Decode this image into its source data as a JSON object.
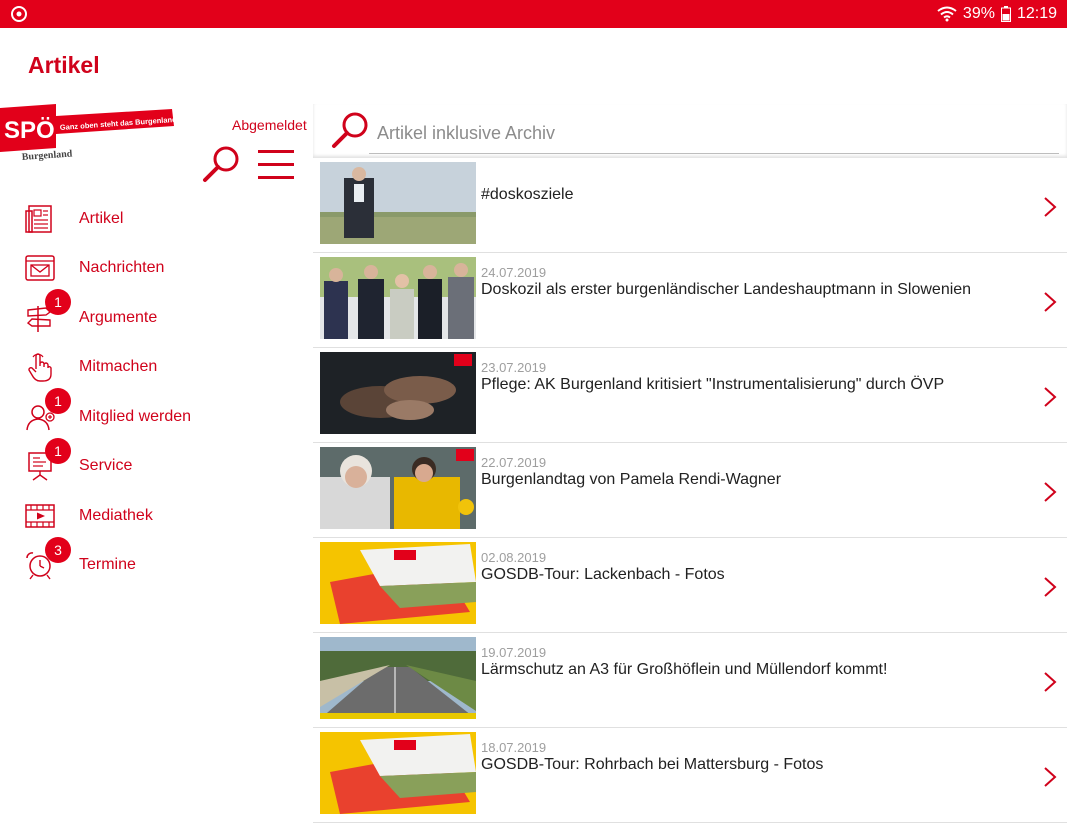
{
  "statusbar": {
    "battery": "39%",
    "time": "12:19"
  },
  "appbar": {
    "title": "Artikel"
  },
  "sidebar": {
    "logo_text": "SPÖ",
    "logo_slogan": "Ganz oben steht das Burgenland.",
    "logo_region": "Burgenland",
    "login_status": "Abgemeldet",
    "items": [
      {
        "label": "Artikel",
        "icon": "newspaper-icon"
      },
      {
        "label": "Nachrichten",
        "icon": "envelope-icon"
      },
      {
        "label": "Argumente",
        "icon": "signpost-icon",
        "badge": "1"
      },
      {
        "label": "Mitmachen",
        "icon": "hand-pointer-icon"
      },
      {
        "label": "Mitglied werden",
        "icon": "add-person-icon",
        "badge": "1"
      },
      {
        "label": "Service",
        "icon": "presentation-board-icon",
        "badge": "1"
      },
      {
        "label": "Mediathek",
        "icon": "film-play-icon"
      },
      {
        "label": "Termine",
        "icon": "alarm-clock-icon",
        "badge": "3"
      }
    ]
  },
  "search": {
    "placeholder": "Artikel inklusive Archiv",
    "value": ""
  },
  "articles": [
    {
      "date": "",
      "title": "#doskosziele"
    },
    {
      "date": "24.07.2019",
      "title": "Doskozil als erster burgenländischer Landeshauptmann in Slowenien"
    },
    {
      "date": "23.07.2019",
      "title": "Pflege: AK Burgenland kritisiert \"Instrumentalisierung\" durch ÖVP"
    },
    {
      "date": "22.07.2019",
      "title": "Burgenlandtag von Pamela Rendi-Wagner"
    },
    {
      "date": "02.08.2019",
      "title": "GOSDB-Tour: Lackenbach - Fotos"
    },
    {
      "date": "19.07.2019",
      "title": "Lärmschutz an A3 für Großhöflein und Müllendorf kommt!"
    },
    {
      "date": "18.07.2019",
      "title": "GOSDB-Tour: Rohrbach bei Mattersburg - Fotos"
    }
  ],
  "colors": {
    "brand": "#e2001a",
    "accent": "#d0021b"
  }
}
